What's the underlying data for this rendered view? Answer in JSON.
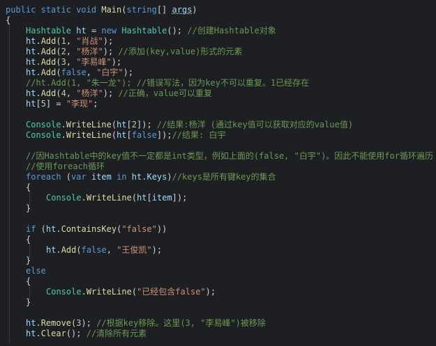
{
  "colors": {
    "background": "#1e1f22",
    "keyword": "#569cd6",
    "type": "#4ec9b0",
    "function": "#dcdcaa",
    "string": "#ce9178",
    "comment": "#6a9955",
    "plain": "#d4d4d4",
    "variable": "#9cdcfe",
    "number": "#b5cea8"
  },
  "lines": [
    {
      "indent": 0,
      "tokens": [
        {
          "t": "public",
          "c": "kw"
        },
        {
          "t": " ",
          "c": "plain"
        },
        {
          "t": "static",
          "c": "kw"
        },
        {
          "t": " ",
          "c": "plain"
        },
        {
          "t": "void",
          "c": "kw"
        },
        {
          "t": " ",
          "c": "plain"
        },
        {
          "t": "Main",
          "c": "fn"
        },
        {
          "t": "(",
          "c": "plain"
        },
        {
          "t": "string",
          "c": "kw"
        },
        {
          "t": "[] ",
          "c": "plain"
        },
        {
          "t": "args",
          "c": "param"
        },
        {
          "t": ")",
          "c": "plain"
        }
      ]
    },
    {
      "indent": 0,
      "tokens": [
        {
          "t": "{",
          "c": "plain"
        }
      ]
    },
    {
      "indent": 1,
      "tokens": [
        {
          "t": "Hashtable",
          "c": "type"
        },
        {
          "t": " ",
          "c": "plain"
        },
        {
          "t": "ht",
          "c": "var"
        },
        {
          "t": " = ",
          "c": "plain"
        },
        {
          "t": "new",
          "c": "kw"
        },
        {
          "t": " ",
          "c": "plain"
        },
        {
          "t": "Hashtable",
          "c": "type"
        },
        {
          "t": "(); ",
          "c": "plain"
        },
        {
          "t": "//创建Hashtable对象",
          "c": "com"
        }
      ]
    },
    {
      "indent": 1,
      "tokens": [
        {
          "t": "ht",
          "c": "var"
        },
        {
          "t": ".",
          "c": "plain"
        },
        {
          "t": "Add",
          "c": "fn"
        },
        {
          "t": "(",
          "c": "plain"
        },
        {
          "t": "1",
          "c": "num"
        },
        {
          "t": ", ",
          "c": "plain"
        },
        {
          "t": "\"肖战\"",
          "c": "str"
        },
        {
          "t": ");",
          "c": "plain"
        }
      ]
    },
    {
      "indent": 1,
      "tokens": [
        {
          "t": "ht",
          "c": "var"
        },
        {
          "t": ".",
          "c": "plain"
        },
        {
          "t": "Add",
          "c": "fn"
        },
        {
          "t": "(",
          "c": "plain"
        },
        {
          "t": "2",
          "c": "num"
        },
        {
          "t": ", ",
          "c": "plain"
        },
        {
          "t": "\"杨洋\"",
          "c": "str"
        },
        {
          "t": "); ",
          "c": "plain"
        },
        {
          "t": "//添加(key,value)形式的元素",
          "c": "com"
        }
      ]
    },
    {
      "indent": 1,
      "tokens": [
        {
          "t": "ht",
          "c": "var"
        },
        {
          "t": ".",
          "c": "plain"
        },
        {
          "t": "Add",
          "c": "fn"
        },
        {
          "t": "(",
          "c": "plain"
        },
        {
          "t": "3",
          "c": "num"
        },
        {
          "t": ", ",
          "c": "plain"
        },
        {
          "t": "\"李易峰\"",
          "c": "str"
        },
        {
          "t": ");",
          "c": "plain"
        }
      ]
    },
    {
      "indent": 1,
      "tokens": [
        {
          "t": "ht",
          "c": "var"
        },
        {
          "t": ".",
          "c": "plain"
        },
        {
          "t": "Add",
          "c": "fn"
        },
        {
          "t": "(",
          "c": "plain"
        },
        {
          "t": "false",
          "c": "kw"
        },
        {
          "t": ", ",
          "c": "plain"
        },
        {
          "t": "\"白宇\"",
          "c": "str"
        },
        {
          "t": ");",
          "c": "plain"
        }
      ]
    },
    {
      "indent": 1,
      "tokens": [
        {
          "t": "//ht.Add(1, \"朱一龙\"); //错误写法，因为key不可以重复。1已经存在",
          "c": "com"
        }
      ]
    },
    {
      "indent": 1,
      "tokens": [
        {
          "t": "ht",
          "c": "var"
        },
        {
          "t": ".",
          "c": "plain"
        },
        {
          "t": "Add",
          "c": "fn"
        },
        {
          "t": "(",
          "c": "plain"
        },
        {
          "t": "4",
          "c": "num"
        },
        {
          "t": ", ",
          "c": "plain"
        },
        {
          "t": "\"杨洋\"",
          "c": "str"
        },
        {
          "t": "); ",
          "c": "plain"
        },
        {
          "t": "//正确，value可以重复",
          "c": "com"
        }
      ]
    },
    {
      "indent": 1,
      "tokens": [
        {
          "t": "ht",
          "c": "var"
        },
        {
          "t": "[",
          "c": "plain"
        },
        {
          "t": "5",
          "c": "num"
        },
        {
          "t": "] = ",
          "c": "plain"
        },
        {
          "t": "\"李现\"",
          "c": "str"
        },
        {
          "t": ";",
          "c": "plain"
        }
      ]
    },
    {
      "indent": 1,
      "tokens": []
    },
    {
      "indent": 1,
      "tokens": [
        {
          "t": "Console",
          "c": "type"
        },
        {
          "t": ".",
          "c": "plain"
        },
        {
          "t": "WriteLine",
          "c": "fn"
        },
        {
          "t": "(",
          "c": "plain"
        },
        {
          "t": "ht",
          "c": "var"
        },
        {
          "t": "[",
          "c": "plain"
        },
        {
          "t": "2",
          "c": "num"
        },
        {
          "t": "]); ",
          "c": "plain"
        },
        {
          "t": "//结果:杨洋 (通过key值可以获取对应的value值)",
          "c": "com"
        }
      ]
    },
    {
      "indent": 1,
      "tokens": [
        {
          "t": "Console",
          "c": "type"
        },
        {
          "t": ".",
          "c": "plain"
        },
        {
          "t": "WriteLine",
          "c": "fn"
        },
        {
          "t": "(",
          "c": "plain"
        },
        {
          "t": "ht",
          "c": "var"
        },
        {
          "t": "[",
          "c": "plain"
        },
        {
          "t": "false",
          "c": "kw"
        },
        {
          "t": "]);",
          "c": "plain"
        },
        {
          "t": "//结果: 白宇",
          "c": "com"
        }
      ]
    },
    {
      "indent": 1,
      "tokens": []
    },
    {
      "indent": 1,
      "tokens": [
        {
          "t": "//因Hashtable中的key值不一定都是int类型，例如上面的(false, \"白宇\")。因此不能使用for循环遍历",
          "c": "com"
        }
      ]
    },
    {
      "indent": 1,
      "tokens": [
        {
          "t": "//使用foreach循环",
          "c": "com"
        }
      ]
    },
    {
      "indent": 1,
      "tokens": [
        {
          "t": "foreach",
          "c": "kw"
        },
        {
          "t": " (",
          "c": "plain"
        },
        {
          "t": "var",
          "c": "kw"
        },
        {
          "t": " ",
          "c": "plain"
        },
        {
          "t": "item",
          "c": "var"
        },
        {
          "t": " ",
          "c": "plain"
        },
        {
          "t": "in",
          "c": "kw"
        },
        {
          "t": " ",
          "c": "plain"
        },
        {
          "t": "ht",
          "c": "var"
        },
        {
          "t": ".",
          "c": "plain"
        },
        {
          "t": "Keys",
          "c": "var"
        },
        {
          "t": ")",
          "c": "plain"
        },
        {
          "t": "//keys是所有键key的集合",
          "c": "com"
        }
      ]
    },
    {
      "indent": 1,
      "tokens": [
        {
          "t": "{",
          "c": "plain"
        }
      ]
    },
    {
      "indent": 2,
      "tokens": [
        {
          "t": "Console",
          "c": "type"
        },
        {
          "t": ".",
          "c": "plain"
        },
        {
          "t": "WriteLine",
          "c": "fn"
        },
        {
          "t": "(",
          "c": "plain"
        },
        {
          "t": "ht",
          "c": "var"
        },
        {
          "t": "[",
          "c": "plain"
        },
        {
          "t": "item",
          "c": "var"
        },
        {
          "t": "]);",
          "c": "plain"
        }
      ]
    },
    {
      "indent": 1,
      "tokens": [
        {
          "t": "}",
          "c": "plain"
        }
      ]
    },
    {
      "indent": 1,
      "tokens": []
    },
    {
      "indent": 1,
      "tokens": [
        {
          "t": "if",
          "c": "kw"
        },
        {
          "t": " (",
          "c": "plain"
        },
        {
          "t": "ht",
          "c": "var"
        },
        {
          "t": ".",
          "c": "plain"
        },
        {
          "t": "ContainsKey",
          "c": "fn"
        },
        {
          "t": "(",
          "c": "plain"
        },
        {
          "t": "\"false\"",
          "c": "str"
        },
        {
          "t": "))",
          "c": "plain"
        }
      ]
    },
    {
      "indent": 1,
      "tokens": [
        {
          "t": "{",
          "c": "plain"
        }
      ]
    },
    {
      "indent": 2,
      "tokens": [
        {
          "t": "ht",
          "c": "var"
        },
        {
          "t": ".",
          "c": "plain"
        },
        {
          "t": "Add",
          "c": "fn"
        },
        {
          "t": "(",
          "c": "plain"
        },
        {
          "t": "false",
          "c": "kw"
        },
        {
          "t": ", ",
          "c": "plain"
        },
        {
          "t": "\"王俊凯\"",
          "c": "str"
        },
        {
          "t": ");",
          "c": "plain"
        }
      ]
    },
    {
      "indent": 1,
      "tokens": [
        {
          "t": "}",
          "c": "plain"
        }
      ]
    },
    {
      "indent": 1,
      "tokens": [
        {
          "t": "else",
          "c": "kw"
        }
      ]
    },
    {
      "indent": 1,
      "tokens": [
        {
          "t": "{",
          "c": "plain"
        }
      ]
    },
    {
      "indent": 2,
      "tokens": [
        {
          "t": "Console",
          "c": "type"
        },
        {
          "t": ".",
          "c": "plain"
        },
        {
          "t": "WriteLine",
          "c": "fn"
        },
        {
          "t": "(",
          "c": "plain"
        },
        {
          "t": "\"已经包含false\"",
          "c": "str"
        },
        {
          "t": ");",
          "c": "plain"
        }
      ]
    },
    {
      "indent": 1,
      "tokens": [
        {
          "t": "}",
          "c": "plain"
        }
      ]
    },
    {
      "indent": 1,
      "tokens": []
    },
    {
      "indent": 1,
      "tokens": [
        {
          "t": "ht",
          "c": "var"
        },
        {
          "t": ".",
          "c": "plain"
        },
        {
          "t": "Remove",
          "c": "fn"
        },
        {
          "t": "(",
          "c": "plain"
        },
        {
          "t": "3",
          "c": "num"
        },
        {
          "t": "); ",
          "c": "plain"
        },
        {
          "t": "//根据key移除。这里(3, \"李易峰\")被移除",
          "c": "com"
        }
      ]
    },
    {
      "indent": 1,
      "tokens": [
        {
          "t": "ht",
          "c": "var"
        },
        {
          "t": ".",
          "c": "plain"
        },
        {
          "t": "Clear",
          "c": "fn"
        },
        {
          "t": "(); ",
          "c": "plain"
        },
        {
          "t": "//清除所有元素",
          "c": "com"
        }
      ]
    }
  ]
}
